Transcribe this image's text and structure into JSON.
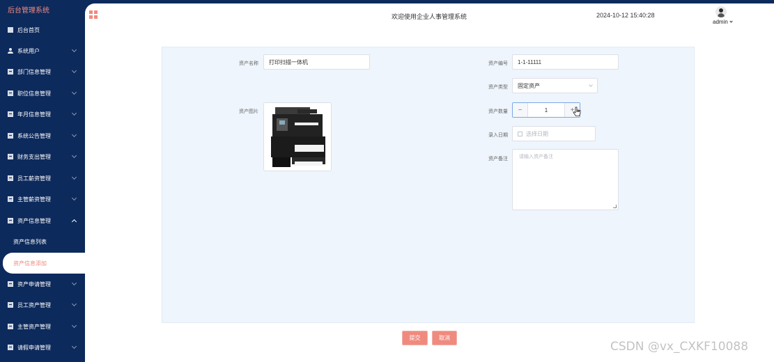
{
  "sidebar": {
    "brand": "后台管理系统",
    "items": [
      {
        "label": "后台首页",
        "icon": "home-icon"
      },
      {
        "label": "系统用户",
        "icon": "user-icon"
      },
      {
        "label": "部门信息管理",
        "icon": "list-icon"
      },
      {
        "label": "职位信息管理",
        "icon": "list-icon"
      },
      {
        "label": "年月信息管理",
        "icon": "list-icon"
      },
      {
        "label": "系统公告管理",
        "icon": "list-icon"
      },
      {
        "label": "财务支出管理",
        "icon": "list-icon"
      },
      {
        "label": "员工薪资管理",
        "icon": "list-icon"
      },
      {
        "label": "主管薪资管理",
        "icon": "list-icon"
      },
      {
        "label": "资产信息管理",
        "icon": "list-icon"
      },
      {
        "label": "资产申请管理",
        "icon": "list-icon"
      },
      {
        "label": "员工资产管理",
        "icon": "list-icon"
      },
      {
        "label": "主管资产管理",
        "icon": "list-icon"
      },
      {
        "label": "请假申请管理",
        "icon": "list-icon"
      }
    ],
    "sub_items": [
      {
        "label": "资产信息列表"
      },
      {
        "label": "资产信息添加"
      }
    ]
  },
  "header": {
    "welcome": "欢迎使用企业人事管理系统",
    "datetime": "2024-10-12 15:40:28",
    "user": "admin"
  },
  "form": {
    "asset_name_label": "资产名称",
    "asset_name_value": "打印扫描一体机",
    "asset_no_label": "资产编号",
    "asset_no_value": "1-1-11111",
    "asset_type_label": "资产类型",
    "asset_type_value": "固定资产",
    "asset_image_label": "资产图片",
    "asset_qty_label": "资产数量",
    "asset_qty_value": "1",
    "entry_date_label": "录入日期",
    "entry_date_placeholder": "选择日期",
    "remark_label": "资产备注",
    "remark_placeholder": "请输入资产备注"
  },
  "actions": {
    "submit_label": "提交",
    "cancel_label": "取消"
  },
  "watermark": "CSDN @vx_CXKF10088",
  "colors": {
    "sidebar_bg": "#0d2a5c",
    "accent": "#f08a7e",
    "panel_bg": "#eef5fc"
  }
}
